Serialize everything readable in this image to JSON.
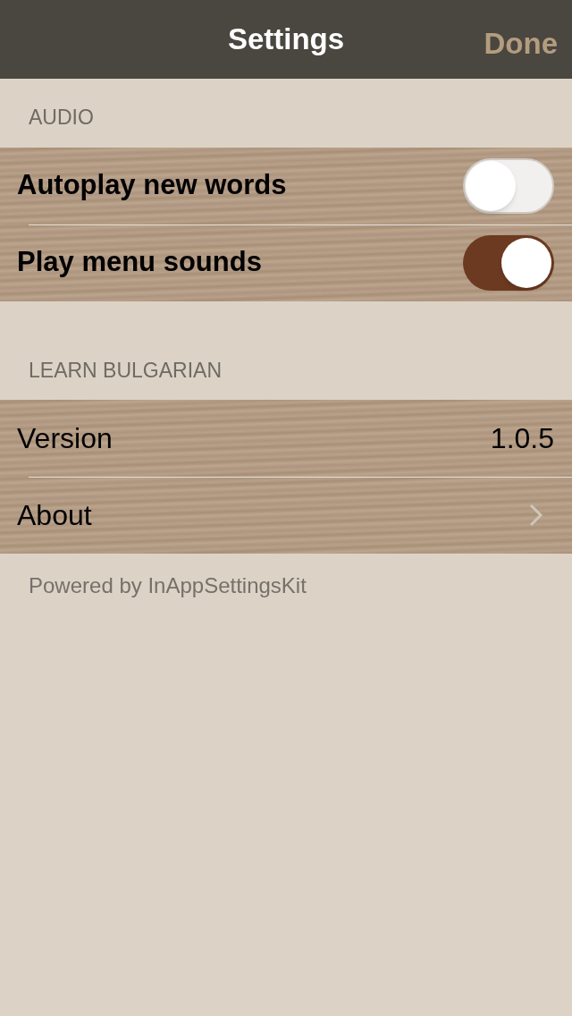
{
  "nav": {
    "title": "Settings",
    "done": "Done"
  },
  "sections": [
    {
      "header": "AUDIO",
      "rows": [
        {
          "kind": "toggle",
          "label": "Autoplay new words",
          "on": false
        },
        {
          "kind": "toggle",
          "label": "Play menu sounds",
          "on": true
        }
      ]
    },
    {
      "header": "LEARN BULGARIAN",
      "rows": [
        {
          "kind": "value",
          "label": "Version",
          "value": "1.0.5"
        },
        {
          "kind": "link",
          "label": "About"
        }
      ]
    }
  ],
  "footer": "Powered by InAppSettingsKit"
}
